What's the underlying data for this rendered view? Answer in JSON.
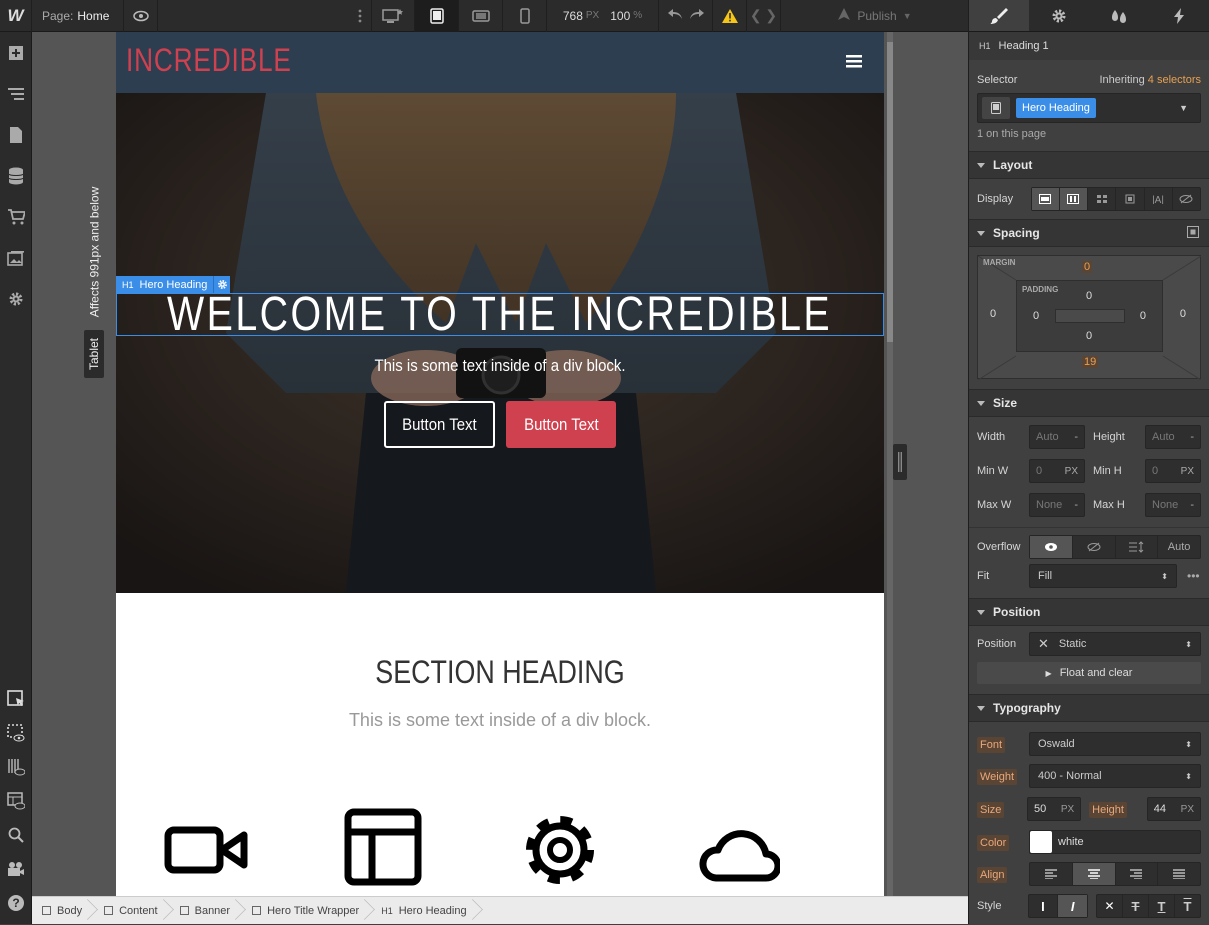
{
  "topbar": {
    "logo": "W",
    "page_label": "Page:",
    "page_name": "Home",
    "width_value": "768",
    "width_unit": "PX",
    "zoom_value": "100",
    "zoom_unit": "%",
    "publish_label": "Publish"
  },
  "canvas": {
    "side_label_affects": "Affects 991px and below",
    "side_label_tablet": "Tablet",
    "brand": "INCREDIBLE",
    "hero_tag_level": "H1",
    "hero_tag_name": "Hero Heading",
    "hero_heading": "WELCOME TO THE INCREDIBLE",
    "hero_subtext": "This is some text inside of a div block.",
    "button_outline": "Button Text",
    "button_filled": "Button Text",
    "section_heading": "SECTION HEADING",
    "section_text": "This is some text inside of a div block."
  },
  "breadcrumbs": [
    {
      "label": "Body",
      "icon": "box-icon"
    },
    {
      "label": "Content",
      "icon": "box-icon"
    },
    {
      "label": "Banner",
      "icon": "box-icon"
    },
    {
      "label": "Hero Title Wrapper",
      "icon": "box-icon"
    },
    {
      "label": "Hero Heading",
      "icon": "h1-icon",
      "prefix": "H1"
    }
  ],
  "panel": {
    "element_tag": "H1",
    "element_type": "Heading 1",
    "selector_label": "Selector",
    "inheriting_label": "Inheriting",
    "inheriting_count": "4 selectors",
    "selector_chip": "Hero Heading",
    "on_page": "1 on this page",
    "layout": {
      "title": "Layout",
      "display_label": "Display"
    },
    "spacing": {
      "title": "Spacing",
      "margin_label": "MARGIN",
      "padding_label": "PADDING",
      "margin_top": "0",
      "margin_left": "0",
      "margin_right": "0",
      "margin_bottom": "19",
      "padding_top": "0",
      "padding_left": "0",
      "padding_right": "0",
      "padding_bottom": "0"
    },
    "size": {
      "title": "Size",
      "width_label": "Width",
      "width_value": "Auto",
      "width_unit": "-",
      "height_label": "Height",
      "height_value": "Auto",
      "height_unit": "-",
      "minw_label": "Min W",
      "minw_value": "0",
      "minw_unit": "PX",
      "minh_label": "Min H",
      "minh_value": "0",
      "minh_unit": "PX",
      "maxw_label": "Max W",
      "maxw_value": "None",
      "maxw_unit": "-",
      "maxh_label": "Max H",
      "maxh_value": "None",
      "maxh_unit": "-",
      "overflow_label": "Overflow",
      "overflow_auto": "Auto",
      "fit_label": "Fit",
      "fit_value": "Fill"
    },
    "position": {
      "title": "Position",
      "position_label": "Position",
      "position_value": "Static",
      "float_label": "Float and clear"
    },
    "typography": {
      "title": "Typography",
      "font_label": "Font",
      "font_value": "Oswald",
      "weight_label": "Weight",
      "weight_value": "400 - Normal",
      "size_label": "Size",
      "size_value": "50",
      "size_unit": "PX",
      "height_label": "Height",
      "height_value": "44",
      "height_unit": "PX",
      "color_label": "Color",
      "color_value": "white",
      "align_label": "Align",
      "style_label": "Style"
    }
  },
  "colors": {
    "brand_red": "#d0414f",
    "nav_bg": "#2d3e50",
    "selection_blue": "#3b8ee8"
  }
}
